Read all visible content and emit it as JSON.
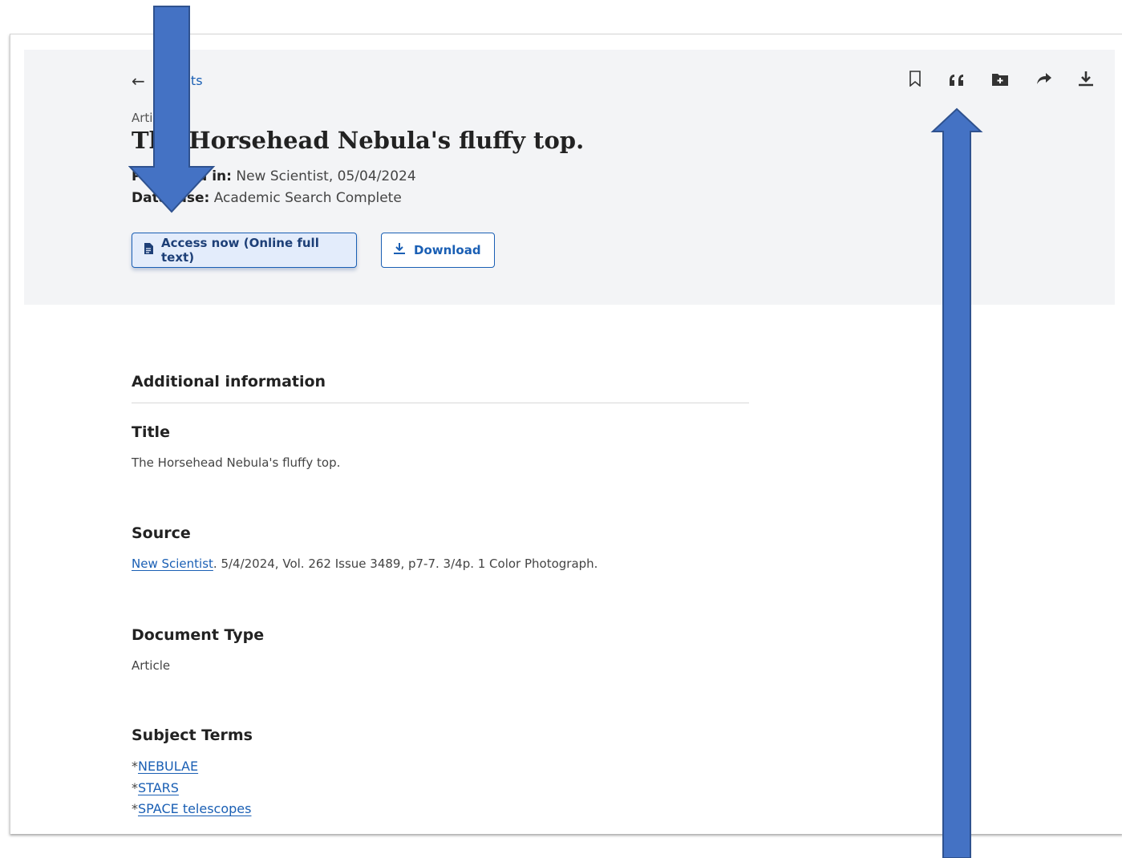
{
  "back": {
    "label": "Results"
  },
  "article": {
    "type_label": "Article",
    "title": "The Horsehead Nebula's fluffy top.",
    "published_label": "Published in:",
    "published_value": "New Scientist, 05/04/2024",
    "database_label": "Database:",
    "database_value": "Academic Search Complete"
  },
  "actions": {
    "access_label": "Access now (Online full text)",
    "download_label": "Download"
  },
  "toolbar": {
    "icons": [
      "bookmark-icon",
      "quote-icon",
      "add-to-folder-icon",
      "share-icon",
      "download-icon"
    ]
  },
  "details": {
    "heading": "Additional information",
    "title_label": "Title",
    "title_value": "The Horsehead Nebula's fluffy top.",
    "source_label": "Source",
    "source_link": "New Scientist",
    "source_rest": ". 5/4/2024, Vol. 262 Issue 3489, p7-7. 3/4p. 1 Color Photograph.",
    "doctype_label": "Document Type",
    "doctype_value": "Article",
    "subjects_label": "Subject Terms",
    "subject_prefix": "*",
    "subjects": [
      "NEBULAE",
      "STARS",
      "SPACE telescopes"
    ]
  },
  "colors": {
    "accent": "#1a5fb4",
    "header_band": "#f3f4f6",
    "annotation_arrow": "#4472c4"
  }
}
